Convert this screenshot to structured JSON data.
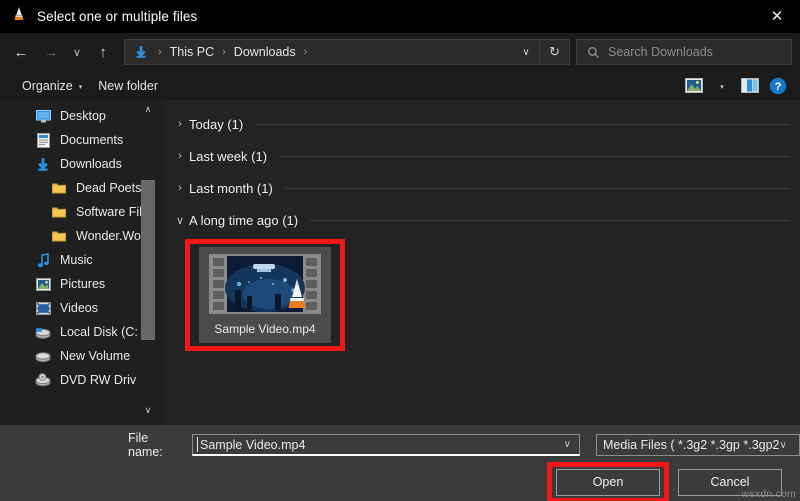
{
  "window": {
    "title": "Select one or multiple files",
    "app_icon": "vlc-cone-icon",
    "close_label": "✕"
  },
  "nav": {
    "back": "←",
    "forward": "→",
    "recent": "∨",
    "up": "↑",
    "address_icon": "downloads-arrow-icon",
    "breadcrumbs": [
      "This PC",
      "Downloads"
    ],
    "crumb_sep": "›",
    "history_chevron": "∨",
    "refresh": "↻"
  },
  "search": {
    "placeholder": "Search Downloads",
    "icon": "search-icon"
  },
  "toolbar": {
    "organize_label": "Organize",
    "organize_caret": "▾",
    "new_folder_label": "New folder",
    "view_icon": "view-layout-icon",
    "view_caret": "▾",
    "preview_pane_icon": "preview-pane-icon",
    "help_label": "?"
  },
  "sidebar": {
    "scroll_up": "∧",
    "scroll_down": "∨",
    "items": [
      {
        "label": "Desktop",
        "icon": "desktop-icon",
        "indent": false
      },
      {
        "label": "Documents",
        "icon": "documents-icon",
        "indent": false
      },
      {
        "label": "Downloads",
        "icon": "downloads-icon",
        "indent": false
      },
      {
        "label": "Dead Poets",
        "icon": "folder-icon",
        "indent": true
      },
      {
        "label": "Software Fil",
        "icon": "folder-icon",
        "indent": true
      },
      {
        "label": "Wonder.Wo",
        "icon": "folder-icon",
        "indent": true
      },
      {
        "label": "Music",
        "icon": "music-icon",
        "indent": false
      },
      {
        "label": "Pictures",
        "icon": "pictures-icon",
        "indent": false
      },
      {
        "label": "Videos",
        "icon": "videos-icon",
        "indent": false
      },
      {
        "label": "Local Disk (C:",
        "icon": "harddisk-icon",
        "indent": false
      },
      {
        "label": "New Volume",
        "icon": "drive-icon",
        "indent": false
      },
      {
        "label": "DVD RW Driv",
        "icon": "dvd-drive-icon",
        "indent": false
      }
    ]
  },
  "filelist": {
    "groups": [
      {
        "title": "Today (1)",
        "chevron": "›",
        "expanded": false
      },
      {
        "title": "Last week (1)",
        "chevron": "›",
        "expanded": false
      },
      {
        "title": "Last month (1)",
        "chevron": "›",
        "expanded": false
      },
      {
        "title": "A long time ago (1)",
        "chevron": "∨",
        "expanded": true
      }
    ],
    "selected_file": {
      "name": "Sample Video.mp4",
      "thumbnail": "video-film-strip-thumbnail",
      "overlay_icon": "vlc-cone-icon",
      "highlight_color": "#f01818"
    }
  },
  "footer": {
    "filename_label": "File name:",
    "filename_value": "Sample Video.mp4",
    "filename_chevron": "∨",
    "filetype_value": "Media Files ( *.3g2 *.3gp *.3gp2",
    "filetype_chevron": "∨",
    "open_label": "Open",
    "cancel_label": "Cancel",
    "open_highlight_color": "#f01818"
  },
  "watermark": "wsxdn.com"
}
